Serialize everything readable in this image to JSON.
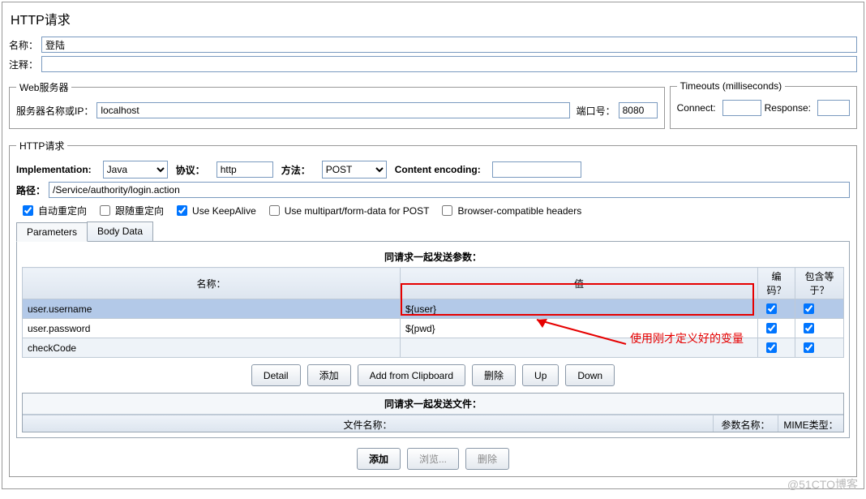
{
  "title": "HTTP请求",
  "labels": {
    "name": "名称：",
    "comment": "注释："
  },
  "values": {
    "name": "登陆",
    "comment": ""
  },
  "webserver": {
    "legend": "Web服务器",
    "serverLabel": "服务器名称或IP：",
    "server": "localhost",
    "portLabel": "端口号：",
    "port": "8080"
  },
  "timeouts": {
    "legend": "Timeouts (milliseconds)",
    "connectLabel": "Connect:",
    "connect": "",
    "responseLabel": "Response:",
    "response": ""
  },
  "httpreq": {
    "legend": "HTTP请求",
    "implLabel": "Implementation:",
    "impl": "Java",
    "protoLabel": "协议：",
    "proto": "http",
    "methodLabel": "方法：",
    "method": "POST",
    "encLabel": "Content encoding:",
    "enc": "",
    "pathLabel": "路径：",
    "path": "/Service/authority/login.action",
    "checks": {
      "autoRedirect": "自动重定向",
      "followRedirect": "跟随重定向",
      "keepAlive": "Use KeepAlive",
      "multipart": "Use multipart/form-data for POST",
      "browserCompat": "Browser-compatible headers"
    },
    "checked": {
      "autoRedirect": true,
      "followRedirect": false,
      "keepAlive": true,
      "multipart": false,
      "browserCompat": false
    }
  },
  "tabs": {
    "parameters": "Parameters",
    "bodyData": "Body Data"
  },
  "paramSection": {
    "title": "同请求一起发送参数：",
    "cols": {
      "name": "名称：",
      "value": "值",
      "encode": "编码？",
      "include": "包含等于？"
    },
    "rows": [
      {
        "name": "user.username",
        "value": "${user}",
        "encode": true,
        "include": true
      },
      {
        "name": "user.password",
        "value": "${pwd}",
        "encode": true,
        "include": true
      },
      {
        "name": "checkCode",
        "value": "",
        "encode": true,
        "include": true
      }
    ],
    "buttons": {
      "detail": "Detail",
      "add": "添加",
      "clipboard": "Add from Clipboard",
      "delete": "删除",
      "up": "Up",
      "down": "Down"
    }
  },
  "annotation": {
    "text": "使用刚才定义好的变量"
  },
  "fileSection": {
    "title": "同请求一起发送文件：",
    "cols": {
      "fileName": "文件名称：",
      "paramName": "参数名称：",
      "mime": "MIME类型："
    },
    "buttons": {
      "add": "添加",
      "browse": "浏览...",
      "delete": "删除"
    }
  },
  "watermark": "@51CTO博客"
}
